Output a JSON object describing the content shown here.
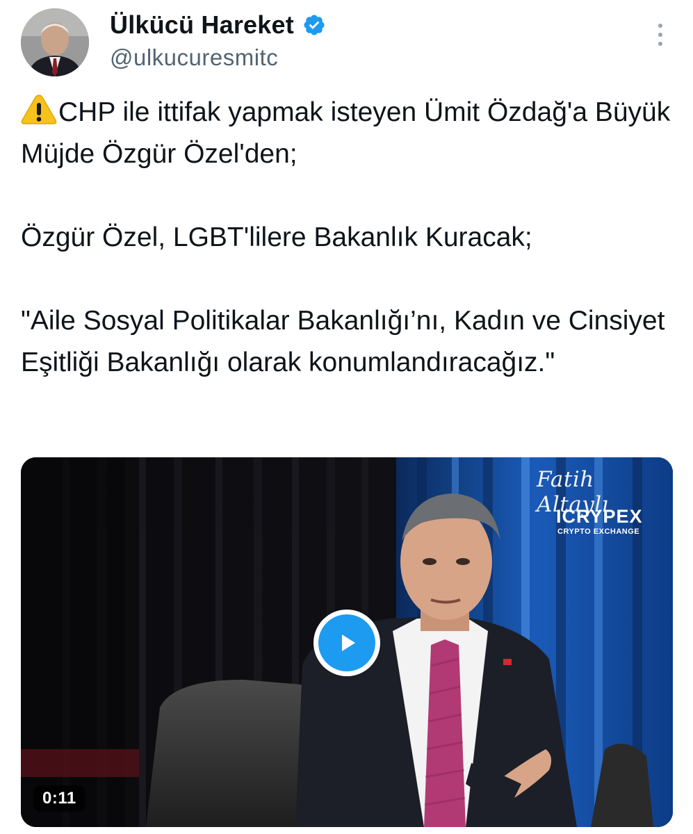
{
  "author": {
    "display_name": "Ülkücü Hareket",
    "handle": "@ulkucuresmitc",
    "verified": true,
    "verified_color": "#1d9bf0"
  },
  "icons": {
    "more": "more-vertical-icon",
    "verified": "verified-badge-icon",
    "warning": "warning-emoji-icon",
    "play": "play-icon"
  },
  "tweet": {
    "line1": "CHP ile ittifak yapmak isteyen Ümit Özdağ'a Büyük Müjde Özgür Özel'den;",
    "line2": "Özgür Özel, LGBT'lilere Bakanlık Kuracak;",
    "line3": "\"Aile Sosyal Politikalar Bakanlığı’nı, Kadın ve Cinsiyet Eşitliği Bakanlığı olarak konumlandıracağız.\""
  },
  "media": {
    "overlay_name": "Fatih Altaylı",
    "overlay_brand": "ICRYPEX",
    "overlay_brand_sub": "CRYPTO EXCHANGE",
    "duration": "0:11",
    "play_color": "#1d9bf0"
  }
}
